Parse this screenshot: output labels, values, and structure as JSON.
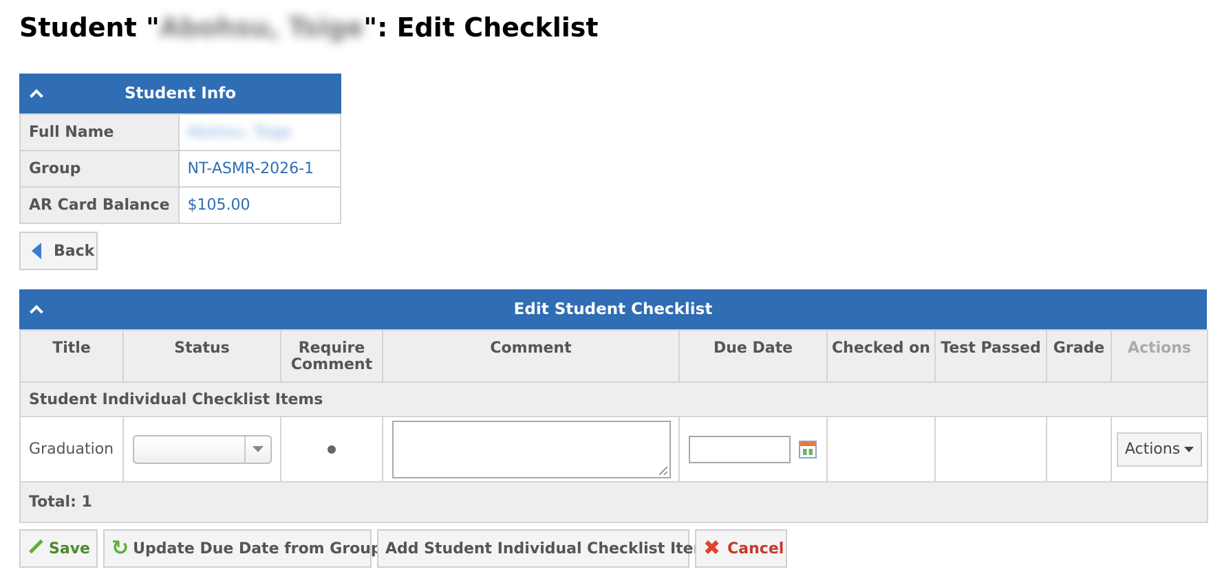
{
  "page": {
    "title_prefix": "Student \"",
    "title_name": "Abohsu, Tsige",
    "title_suffix": "\": Edit Checklist"
  },
  "student_info": {
    "header": "Student Info",
    "rows": [
      {
        "label": "Full Name",
        "value": "Abohsu, Tsige"
      },
      {
        "label": "Group",
        "value": "NT-ASMR-2026-1"
      },
      {
        "label": "AR Card Balance",
        "value": "$105.00"
      }
    ]
  },
  "back_button": {
    "label": "Back",
    "icon": "triangle-left-icon"
  },
  "checklist": {
    "header": "Edit Student Checklist",
    "columns": [
      "Title",
      "Status",
      "Require Comment",
      "Comment",
      "Due Date",
      "Checked on",
      "Test Passed",
      "Grade",
      "Actions"
    ],
    "group_label": "Student Individual Checklist Items",
    "items": [
      {
        "title": "Graduation",
        "status": "",
        "require_comment": true,
        "comment": "",
        "due_date": "",
        "checked_on": "",
        "test_passed": "",
        "grade": "",
        "actions_label": "Actions"
      }
    ],
    "total_label": "Total: 1"
  },
  "footer_buttons": {
    "save": "Save",
    "update_due_date": "Update Due Date from Group",
    "add_item": "Add Student Individual Checklist Item",
    "cancel": "Cancel"
  },
  "colors": {
    "header_blue": "#2f6db4",
    "link_blue": "#2f6db4",
    "save_green": "#4c8a2a",
    "cancel_red": "#c63a2a"
  }
}
